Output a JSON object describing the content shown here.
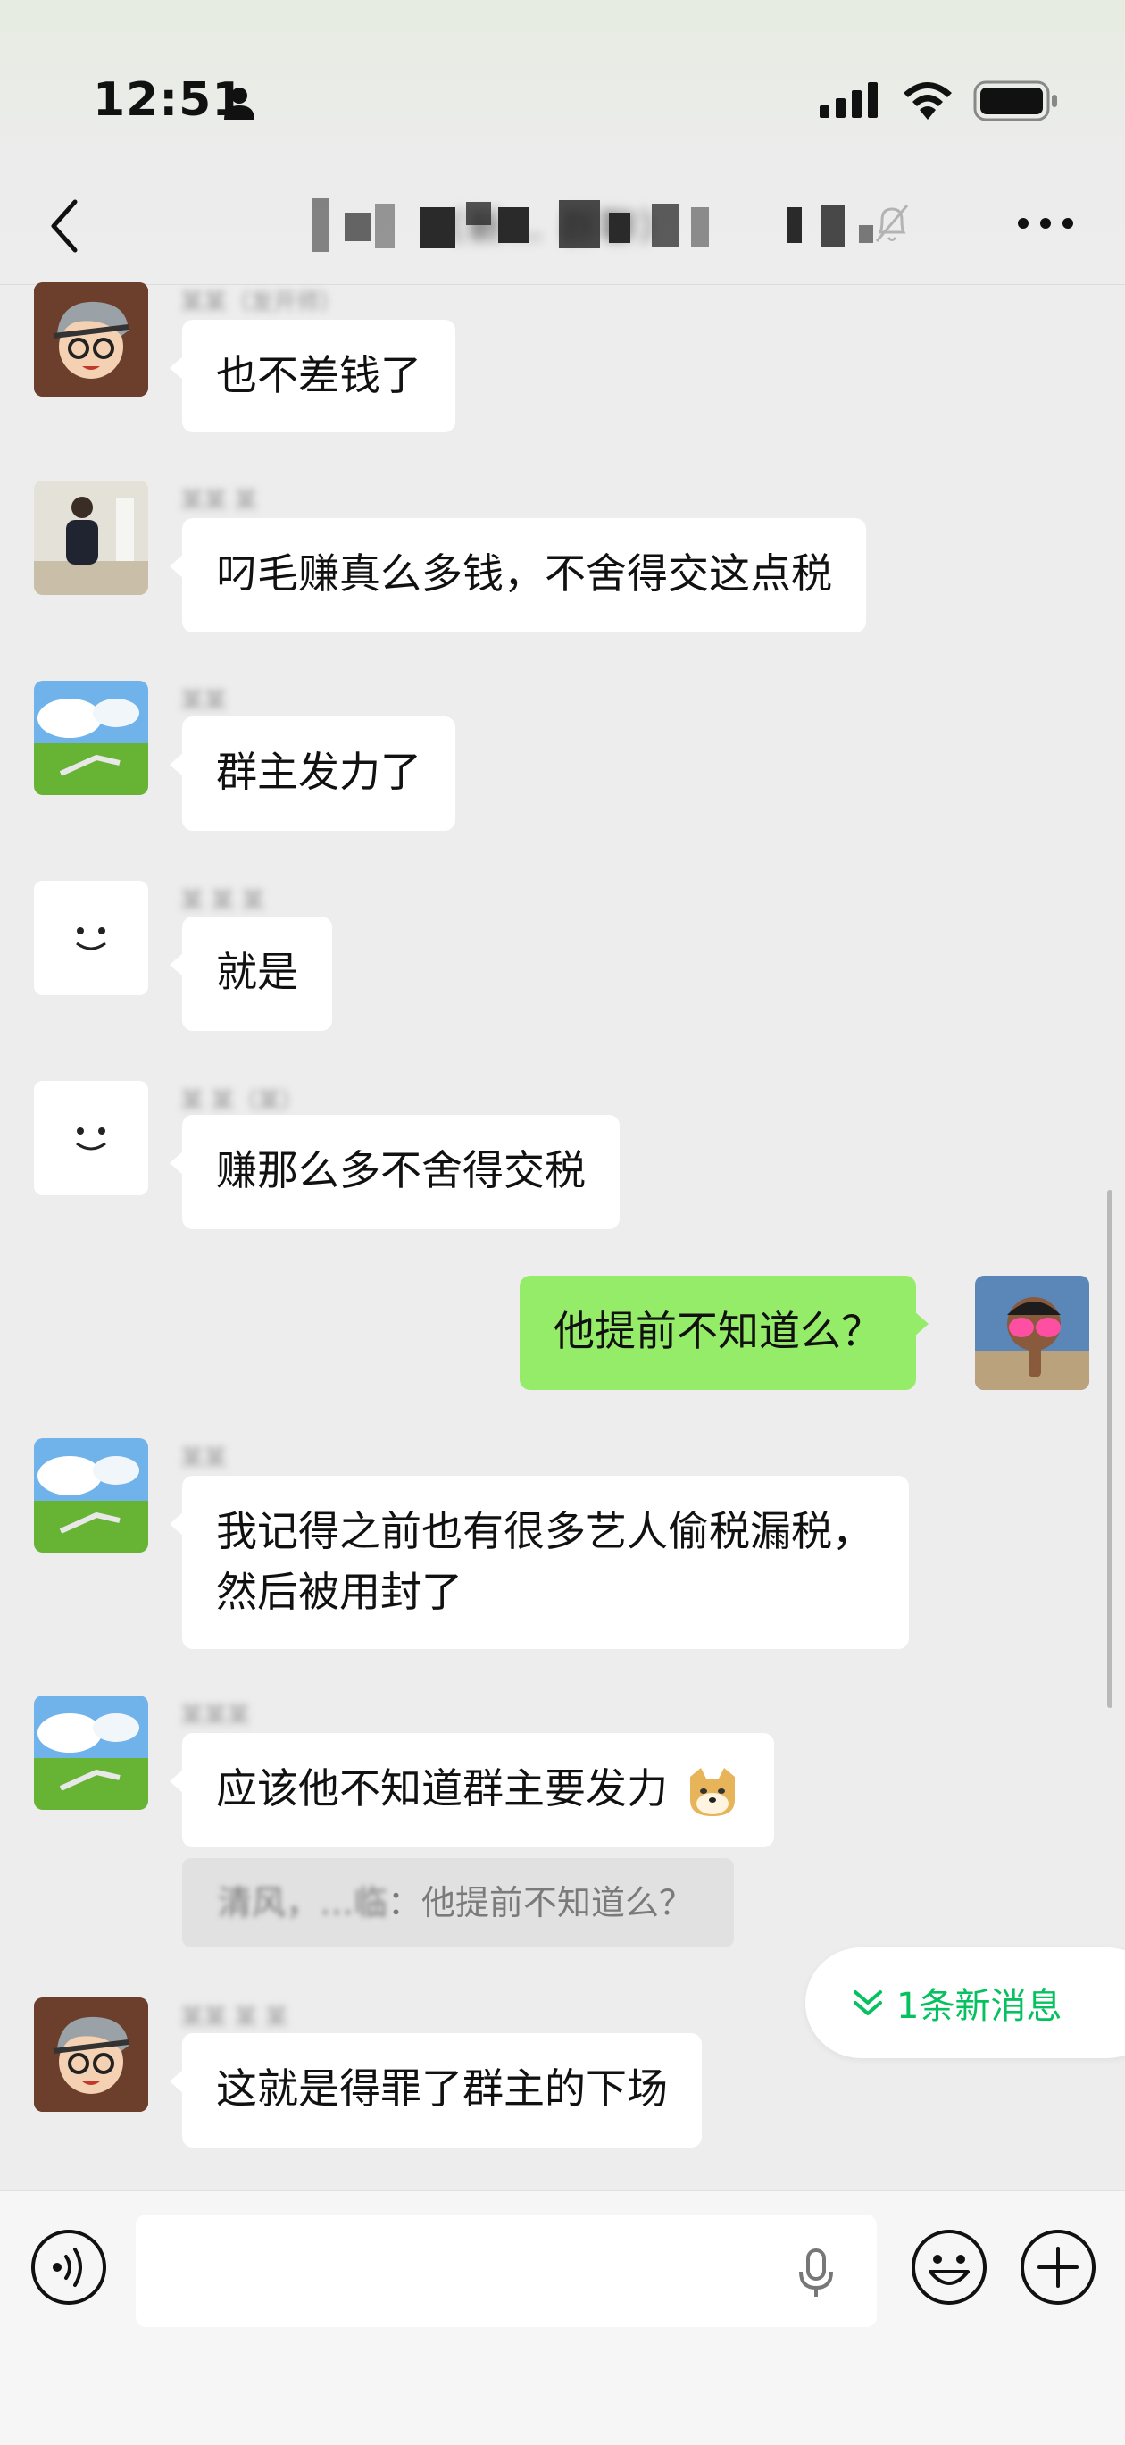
{
  "status_bar": {
    "time": "12:51"
  },
  "header": {
    "title": "（新… 群聊）"
  },
  "messages": [
    {
      "side": "left",
      "sender": "某某（发开师）",
      "text": "也不差钱了"
    },
    {
      "side": "left",
      "sender": "某某 某",
      "text": "叼毛赚真么多钱，不舍得交这点税"
    },
    {
      "side": "left",
      "sender": "某某",
      "text": "群主发力了"
    },
    {
      "side": "left",
      "sender": "某 某 某",
      "text": "就是"
    },
    {
      "side": "left",
      "sender": "某 某（某）",
      "text": "赚那么多不舍得交税"
    },
    {
      "side": "right",
      "text": "他提前不知道么？"
    },
    {
      "side": "left",
      "sender": "某某",
      "text": "我记得之前也有很多艺人偷税漏税，然后被用封了"
    },
    {
      "side": "left",
      "sender": "某某某",
      "text": "应该他不知道群主要发力"
    },
    {
      "side": "left",
      "sender": "某某  某  某",
      "text": "这就是得罪了群主的下场"
    }
  ],
  "quote": {
    "name": "清风，…临",
    "text": "：他提前不知道么？"
  },
  "new_message_pill": {
    "label": "1条新消息"
  },
  "input": {
    "placeholder": ""
  },
  "colors": {
    "accent": "#07c160",
    "self_bubble": "#95ec69",
    "background": "#ededed"
  }
}
